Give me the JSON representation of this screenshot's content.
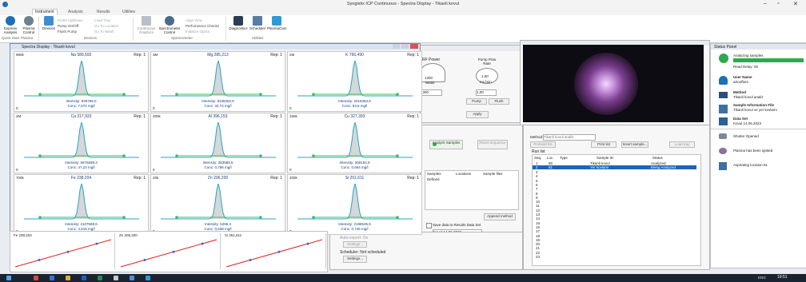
{
  "app_title": "Syngistix ICP Continuous - Spectra Display - Tikanli kovul",
  "tabs": [
    "Instrument",
    "Analysis",
    "Results",
    "Utilities"
  ],
  "ribbon": {
    "buttons": [
      {
        "label": "Express Analysis"
      },
      {
        "label": "Plasma Control"
      },
      {
        "label": "Devices"
      },
      {
        "label": "Continuous Graphics"
      },
      {
        "label": "Spectrometer Control"
      },
      {
        "label": "Performance Checks"
      },
      {
        "label": "Diagnostics"
      },
      {
        "label": "Scheduler"
      },
      {
        "label": "PlasmaCam"
      }
    ],
    "small": {
      "probe": "Probe Up/Down",
      "pump": "Pump On/Off",
      "flush": "Flush Pump",
      "load_tray": "Load Tray",
      "go_location": "Go To Location",
      "go_wash": "Go To Wash",
      "align_view": "Align View",
      "initialize_optics": "Initialize Optics"
    },
    "groups": [
      "Quick Start",
      "Plasma",
      "Devices",
      "Spectrometer",
      "Utilities"
    ]
  },
  "spectra": {
    "title": "Spectra Display - Tikanli kovul",
    "cells": [
      {
        "element": "Na 589,592",
        "rep": "Rep: 1",
        "upper": "960k",
        "lower": "0",
        "intensity": "Intensity: 948786,0",
        "conc": "Conc: 7,672 mg/l"
      },
      {
        "element": "Mg 285,213",
        "rep": "Rep: 1",
        "upper": "3M",
        "lower": "0",
        "intensity": "Intensity: 9348262,9",
        "conc": "Conc: 32,74 mg/l"
      },
      {
        "element": "K 766,490",
        "rep": "Rep: 1",
        "upper": "2M",
        "lower": "0",
        "intensity": "Intensity: 2015363,9",
        "conc": "Conc: 53,6 mg/l"
      },
      {
        "element": "Ca 317,933",
        "rep": "Rep: 1",
        "upper": "2M",
        "lower": "0",
        "intensity": "Intensity: 5675698,3",
        "conc": "Conc: 47,23 mg/l"
      },
      {
        "element": "Al 396,153",
        "rep": "Rep: 1",
        "upper": "200k",
        "lower": "0",
        "intensity": "Intensity: 383589,5",
        "conc": "Conc: 0,786 mg/l"
      },
      {
        "element": "Cu 327,393",
        "rep": "Rep: 1",
        "upper": "150k",
        "lower": "0",
        "intensity": "Intensity: 358184,9",
        "conc": "Conc: 0,684 mg/l"
      },
      {
        "element": "Fe 238,204",
        "rep": "Rep: 1",
        "upper": "700k",
        "lower": "0",
        "intensity": "Intensity: 2107569,6",
        "conc": "Conc: 4,515 mg/l"
      },
      {
        "element": "Zn 206,200",
        "rep": "Rep: 1",
        "upper": "20k",
        "lower": "0",
        "intensity": "Intensity: 5295,3",
        "conc": "Conc: 0,638 mg/l"
      },
      {
        "element": "Si 251,611",
        "rep": "Rep: 1",
        "upper": "200k",
        "lower": "0",
        "intensity": "Intensity: 2198535,9",
        "conc": "Conc: 0,745 mg/l"
      }
    ]
  },
  "calib": [
    "Fe 238,204",
    "Zn 206,200",
    "Si 251,611"
  ],
  "plasma": {
    "rf_power_label": "RF Power",
    "rf_value": "1300",
    "rf_unit": "Watts",
    "rf_input": "1300",
    "pump_label": "Pump Flow Rate",
    "pump_value": "1,00",
    "pump_unit": "mL/min",
    "pump_input": "1,00",
    "apply": "Apply",
    "pump_btn": "Pump",
    "flush_btn": "Flush"
  },
  "analysis": {
    "analyze_btn": "Analyze Samples",
    "reset_btn": "Reset Sequence",
    "cols": [
      "Samples",
      "Locations",
      "Sample files"
    ],
    "row_name": "Defined",
    "append_btn": "Append method",
    "save_label": "Save data to Results Data Set",
    "dataset": "Kovul 14.06.2023",
    "autostart_label": "Auto-export: On",
    "settings1": "Settings...",
    "scheduler": "Scheduler: Not scheduled",
    "settings2": "Settings..."
  },
  "method_panel": {
    "method_label": "Method:",
    "method_value": "Tikanli kovul analiz",
    "preset_btn": "Prebuild list",
    "print_btn": "Print list",
    "insert_btn": "Insert sample...",
    "load_btn": "Load tray",
    "runlist_title": "Run list",
    "cols": [
      "Seq.",
      "Loc.",
      "Type",
      "Sample ID",
      "Status"
    ],
    "rows": [
      {
        "seq": "1",
        "loc": "80",
        "type": "",
        "id": "Tikanli kovul",
        "status": "Analyzed"
      },
      {
        "seq": "2",
        "loc": "81",
        "type": "",
        "id": "Yer kovlami",
        "status": "Being Analyzed"
      }
    ],
    "empty_rows": [
      "3",
      "4",
      "5",
      "6",
      "7",
      "8",
      "9",
      "10",
      "11",
      "12",
      "13",
      "14",
      "15",
      "16",
      "17",
      "18",
      "19",
      "20",
      "21",
      "22",
      "23"
    ]
  },
  "status_panel": {
    "title": "Status Panel",
    "analyzing": "Analyzing samples",
    "read_delay": "Read Delay: 55",
    "user_name_label": "User Name",
    "user_name": "artoofbes",
    "method_label": "Method",
    "method_value": "Tikanli kovul analiz",
    "sif_label": "Sample Information File",
    "sif_value": "Tikanli kovul ve yer kovlami",
    "dataset_label": "Data Set",
    "dataset_value": "Kovul 14.06.2023",
    "events": [
      "Shutter Opened",
      "Plasma has been ignited",
      "Aspirating location 81"
    ]
  },
  "taskbar": {
    "lang": "ENG",
    "time": "19:51"
  },
  "colors": {
    "accent": "#1e6fb5",
    "peak_line": "#29a5c4",
    "baseline": "#3ac15a",
    "status_green": "#2fa84f"
  }
}
